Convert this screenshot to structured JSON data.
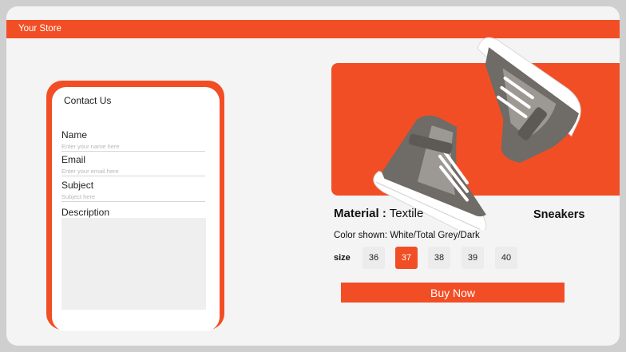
{
  "header": {
    "store_name": "Your Store"
  },
  "contact": {
    "title": "Contact Us",
    "name_label": "Name",
    "name_placeholder": "Enter your name here",
    "email_label": "Email",
    "email_placeholder": "Enter your email here",
    "subject_label": "Subject",
    "subject_placeholder": "Subject here",
    "description_label": "Description"
  },
  "product": {
    "material_key": "Material :",
    "material_value": "Textile",
    "name": "Sneakers",
    "color_key": "Color shown:",
    "color_value": "White/Total Grey/Dark",
    "size_label": "size",
    "sizes": [
      "36",
      "37",
      "38",
      "39",
      "40"
    ],
    "selected_size": "37",
    "buy_label": "Buy Now",
    "image_icon": "sneaker-pair-image"
  },
  "colors": {
    "accent": "#f24e25",
    "background": "#f4f4f4"
  }
}
